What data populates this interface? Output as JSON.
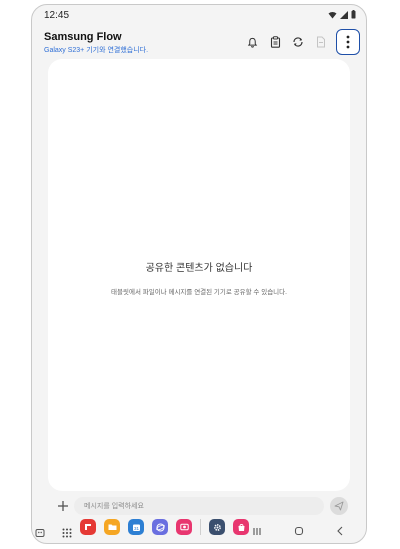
{
  "status_bar": {
    "time": "12:45",
    "icons": [
      "wifi-icon",
      "signal-icon",
      "battery-icon"
    ]
  },
  "header": {
    "title": "Samsung Flow",
    "subtitle": "Galaxy S23+ 기기와 연결했습니다.",
    "actions": [
      "bell-icon",
      "clipboard-icon",
      "sync-icon",
      "file-icon",
      "more-options-icon"
    ]
  },
  "empty_state": {
    "title": "공유한 콘텐츠가 없습니다",
    "description": "태블릿에서 파일이나 메시지를 연결된 기기로 공유할 수 있습니다."
  },
  "composer": {
    "placeholder": "메시지를 입력하세요",
    "value": ""
  },
  "nav_bar": {
    "dock_apps": [
      {
        "name": "flipboard-app-icon",
        "color": "#e53935"
      },
      {
        "name": "my-files-app-icon",
        "color": "#f5a623"
      },
      {
        "name": "calendar-app-icon",
        "color": "#2d7fd3"
      },
      {
        "name": "internet-app-icon",
        "color": "#6a6fe0"
      },
      {
        "name": "screen-recorder-app-icon",
        "color": "#e8366f"
      },
      {
        "name": "settings-app-icon",
        "color": "#3b4f6e"
      },
      {
        "name": "galaxy-store-app-icon",
        "color": "#e8366f"
      }
    ],
    "keys": [
      "recents-icon",
      "home-icon",
      "back-icon"
    ]
  },
  "colors": {
    "accent": "#1e4fa8",
    "subtitle_blue": "#2f6fd6",
    "background": "#f4f4f4"
  }
}
